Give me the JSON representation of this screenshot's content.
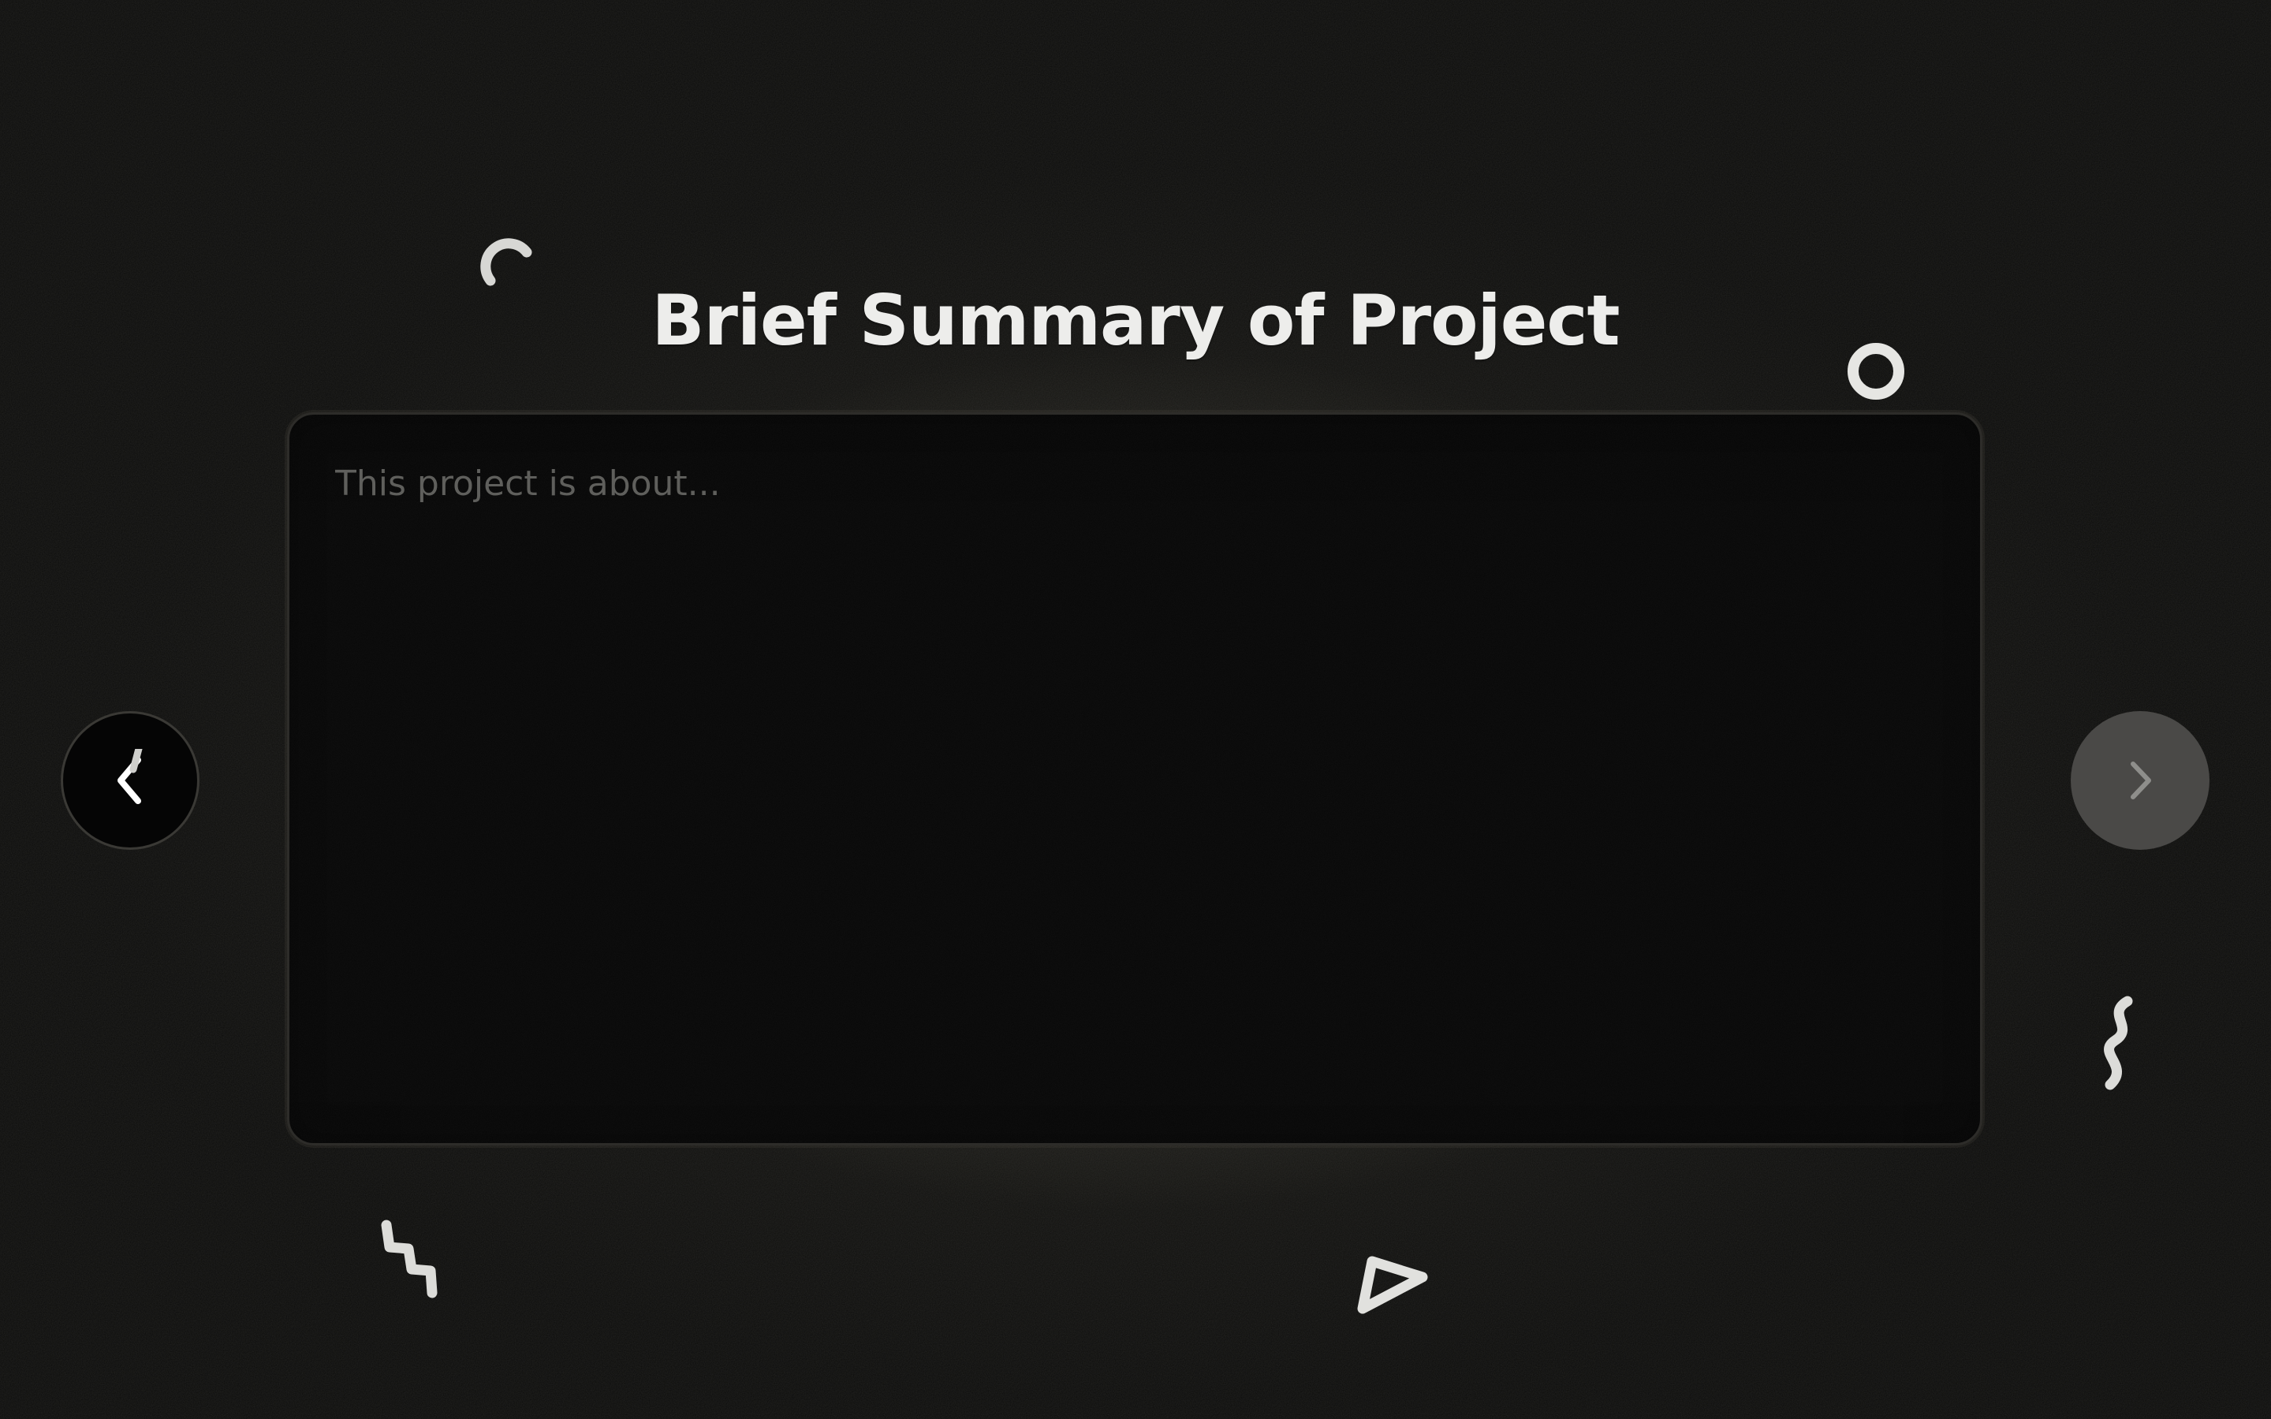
{
  "page": {
    "title": "Brief Summary of Project"
  },
  "summary": {
    "placeholder": "This project is about...",
    "value": ""
  },
  "navigation": {
    "prev_icon": "chevron-left-icon",
    "next_icon": "chevron-right-icon",
    "next_enabled": false
  },
  "colors": {
    "background": "#0b0b0a",
    "glow": "#565446",
    "card": "#060606",
    "title": "#ededeb",
    "placeholder": "#5f5f5c",
    "next_button": "#4a4947"
  }
}
